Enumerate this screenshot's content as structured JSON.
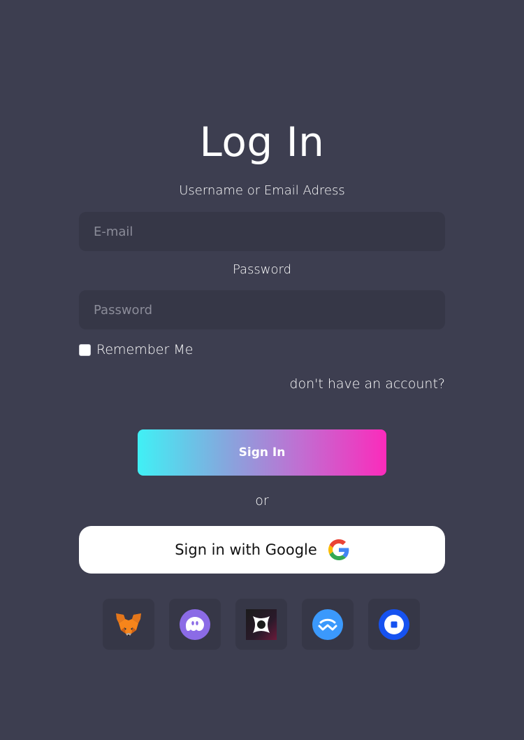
{
  "title": "Log In",
  "form": {
    "username_label": "Username or Email Adress",
    "email_placeholder": "E-mail",
    "password_label": "Password",
    "password_placeholder": "Password",
    "remember_label": "Remember Me",
    "remember_checked": false,
    "account_link": "don't have an account?"
  },
  "actions": {
    "signin_label": "Sign In",
    "or_text": "or",
    "google_label": "Sign in with Google"
  },
  "wallets": [
    {
      "icon": "metamask-fox-icon"
    },
    {
      "icon": "phantom-ghost-icon"
    },
    {
      "icon": "square-logo-icon"
    },
    {
      "icon": "walletconnect-icon"
    },
    {
      "icon": "coinbase-wallet-icon"
    }
  ],
  "colors": {
    "background": "#3d3e50",
    "input_background": "#363747",
    "gradient_start": "#40f0f5",
    "gradient_end": "#fb2bbb"
  }
}
